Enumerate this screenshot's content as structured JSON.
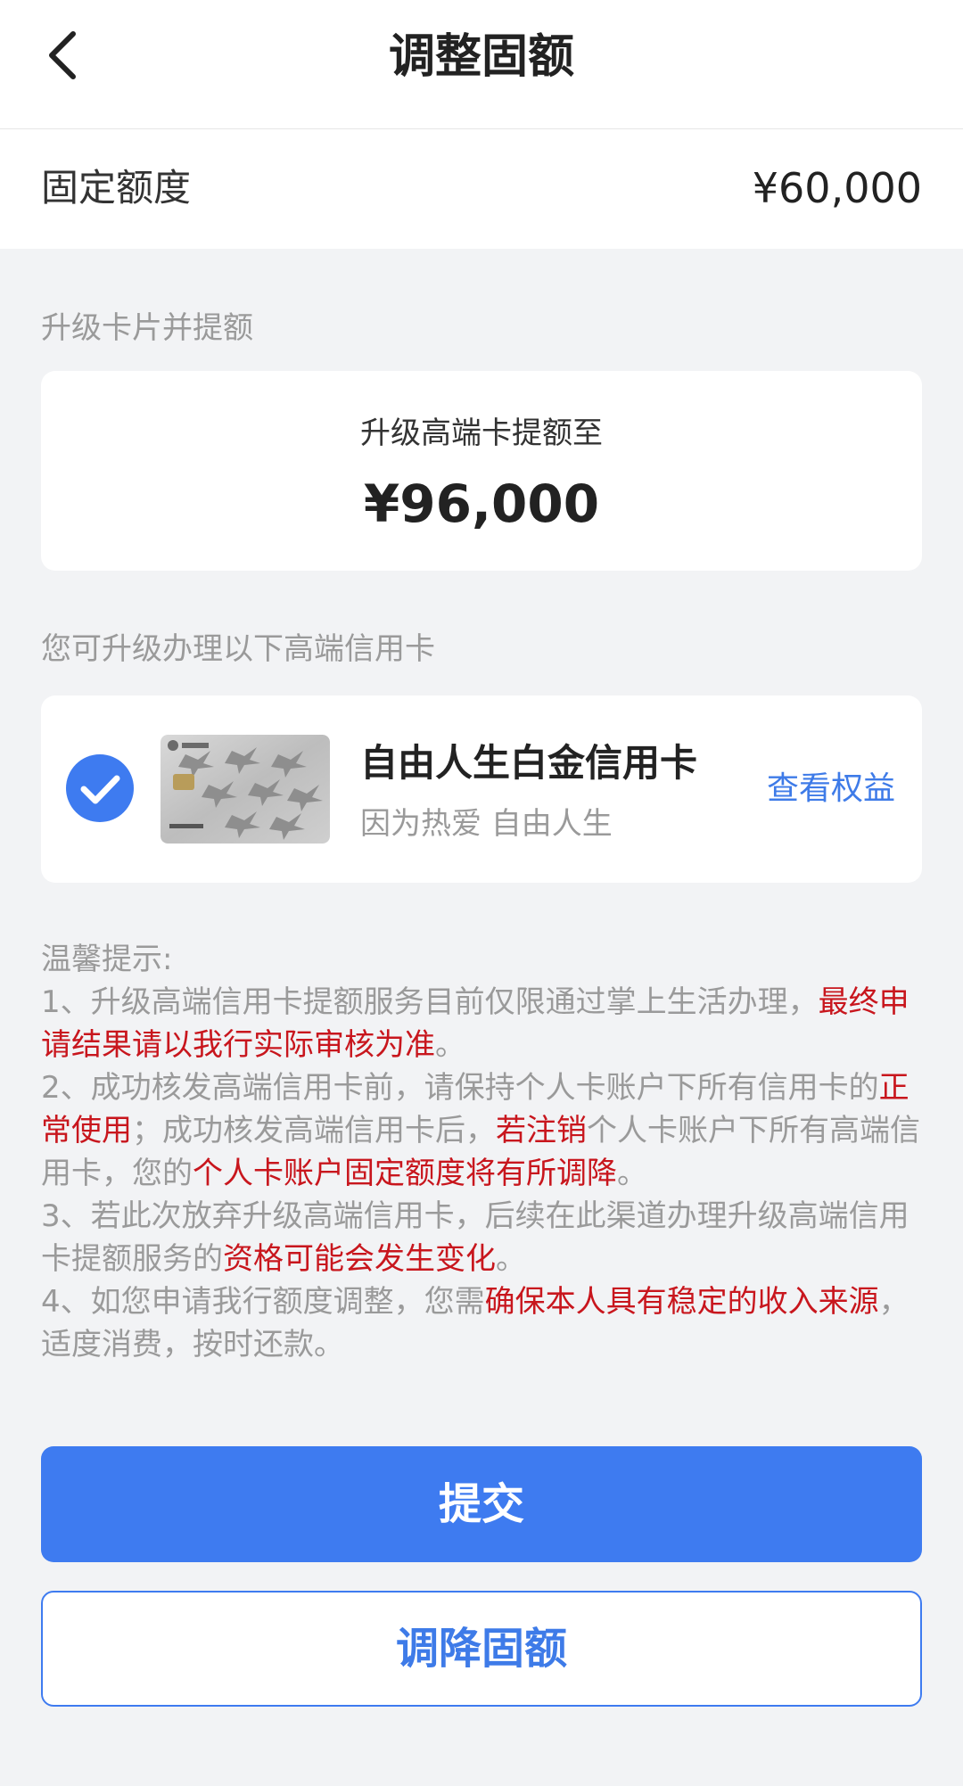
{
  "header": {
    "title": "调整固额",
    "back_icon": "chevron-left-icon"
  },
  "quota": {
    "label": "固定额度",
    "value": "¥60,000"
  },
  "upgrade": {
    "section_label": "升级卡片并提额",
    "caption": "升级高端卡提额至",
    "amount": "¥96,000"
  },
  "card_options": {
    "section_label": "您可升级办理以下高端信用卡",
    "items": [
      {
        "name": "自由人生白金信用卡",
        "slogan": "因为热爱 自由人生",
        "link_label": "查看权益",
        "selected": true,
        "check_icon": "check-circle-icon"
      }
    ]
  },
  "tips": {
    "title": "温馨提示:",
    "item1_a": "1、升级高端信用卡提额服务目前仅限通过掌上生活办理，",
    "item1_b": "最终申请结果请以我行实际审核为准",
    "item1_c": "。",
    "item2_a": "2、成功核发高端信用卡前，请保持个人卡账户下所有信用卡的",
    "item2_b": "正常使用",
    "item2_c": "；成功核发高端信用卡后，",
    "item2_d": "若注销",
    "item2_e": "个人卡账户下所有高端信用卡，您的",
    "item2_f": "个人卡账户固定额度将有所调降",
    "item2_g": "。",
    "item3_a": "3、若此次放弃升级高端信用卡，后续在此渠道办理升级高端信用卡提额服务的",
    "item3_b": "资格可能会发生变化",
    "item3_c": "。",
    "item4_a": "4、如您申请我行额度调整，您需",
    "item4_b": "确保本人具有稳定的收入来源",
    "item4_c": "，适度消费，按时还款。"
  },
  "actions": {
    "submit": "提交",
    "reduce": "调降固额"
  },
  "colors": {
    "primary": "#3e7bf0",
    "warning": "#c8161d",
    "background": "#f2f3f5"
  }
}
